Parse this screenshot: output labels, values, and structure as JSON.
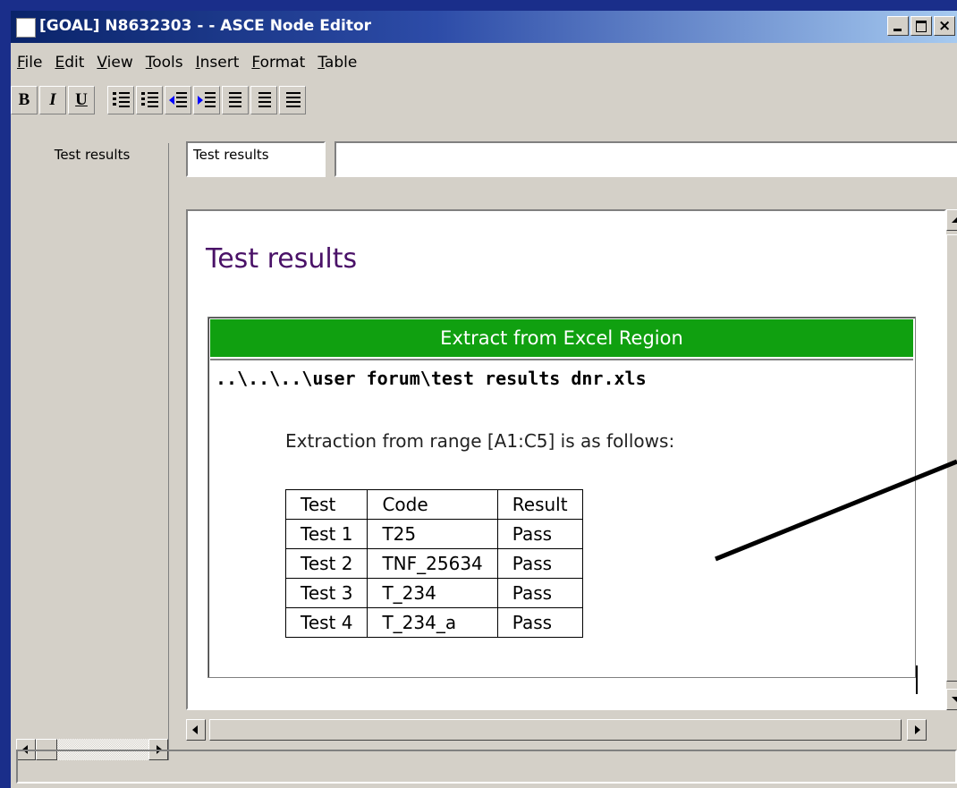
{
  "window": {
    "title": "[GOAL] N8632303 -  - ASCE Node Editor",
    "controls": [
      "minimize",
      "maximize",
      "close"
    ]
  },
  "menu": [
    "File",
    "Edit",
    "View",
    "Tools",
    "Insert",
    "Format",
    "Table"
  ],
  "toolbar": {
    "bold": "B",
    "italic": "I",
    "underline": "U",
    "icons": [
      "numbered-list-icon",
      "bullet-list-icon",
      "decrease-indent-icon",
      "increase-indent-icon",
      "align-left-icon",
      "align-center-icon",
      "align-right-icon"
    ]
  },
  "left_pane": {
    "tab_label": "Test results"
  },
  "fields": {
    "name_value": "Test results",
    "description_value": ""
  },
  "editor": {
    "heading": "Test results",
    "region": {
      "header": "Extract from Excel Region",
      "header_color": "#10a010",
      "path": "..\\..\\..\\user forum\\test results dnr.xls",
      "description": "Extraction from range [A1:C5] is as follows:",
      "table": {
        "headers": [
          "Test",
          "Code",
          "Result"
        ],
        "rows": [
          [
            "Test 1",
            "T25",
            "Pass"
          ],
          [
            "Test 2",
            "TNF_25634",
            "Pass"
          ],
          [
            "Test 3",
            "T_234",
            "Pass"
          ],
          [
            "Test 4",
            "T_234_a",
            "Pass"
          ]
        ]
      }
    }
  },
  "colors": {
    "desktop": "#1a2e8a",
    "heading": "#4a1268",
    "titlebar_start": "#0a246a"
  }
}
